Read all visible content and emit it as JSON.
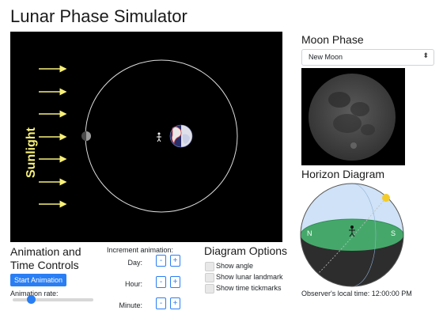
{
  "app": {
    "title": "Lunar Phase Simulator"
  },
  "orbit_view": {
    "sunlight_label": "Sunlight",
    "colors": {
      "background": "#000000",
      "arrows": "#f7f078",
      "orbit": "#dddddd",
      "moon": "#888888"
    }
  },
  "animation_controls": {
    "title": "Animation and Time Controls",
    "start_button_label": "Start Animation",
    "rate_label": "Animation rate:",
    "rate_value": 0.2,
    "increment_label": "Increment animation:",
    "increments": [
      {
        "label": "Day:",
        "minus": "-",
        "plus": "+"
      },
      {
        "label": "Hour:",
        "minus": "-",
        "plus": "+"
      },
      {
        "label": "Minute:",
        "minus": "-",
        "plus": "+"
      }
    ]
  },
  "diagram_options": {
    "title": "Diagram Options",
    "options": [
      {
        "label": "Show angle",
        "checked": false
      },
      {
        "label": "Show lunar landmark",
        "checked": false
      },
      {
        "label": "Show time tickmarks",
        "checked": false
      }
    ]
  },
  "moon_phase": {
    "title": "Moon Phase",
    "selected": "New Moon",
    "caret": "⬍"
  },
  "horizon": {
    "title": "Horizon Diagram",
    "directions": {
      "north": "N",
      "south": "S"
    },
    "local_time_label": "Observer's local time:",
    "local_time": "12:00:00 PM",
    "colors": {
      "sky": "#cfe2f7",
      "ground": "#45a86a",
      "below": "#2d2d2d",
      "sun": "#f4cc2a"
    }
  },
  "accent_color": "#2a7ef4"
}
